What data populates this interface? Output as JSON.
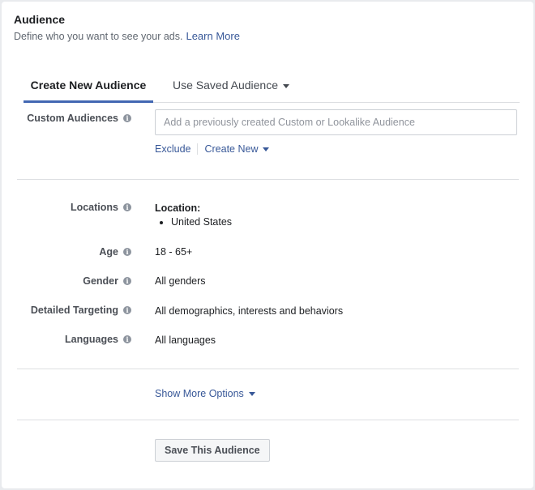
{
  "header": {
    "title": "Audience",
    "subtitle": "Define who you want to see your ads.",
    "learn_more": "Learn More"
  },
  "tabs": [
    {
      "label": "Create New Audience",
      "active": true
    },
    {
      "label": "Use Saved Audience",
      "active": false
    }
  ],
  "custom_audiences": {
    "label": "Custom Audiences",
    "placeholder": "Add a previously created Custom or Lookalike Audience",
    "value": "",
    "exclude": "Exclude",
    "create_new": "Create New"
  },
  "targeting": {
    "locations": {
      "label": "Locations",
      "heading": "Location:",
      "items": [
        "United States"
      ]
    },
    "age": {
      "label": "Age",
      "value": "18 - 65+"
    },
    "gender": {
      "label": "Gender",
      "value": "All genders"
    },
    "detailed": {
      "label": "Detailed Targeting",
      "value": "All demographics, interests and behaviors"
    },
    "languages": {
      "label": "Languages",
      "value": "All languages"
    }
  },
  "show_more": "Show More Options",
  "save_button": "Save This Audience",
  "colors": {
    "accent": "#4267b2",
    "link": "#385898"
  },
  "icons": {
    "info": "info-circle-icon",
    "caret": "caret-down-icon"
  }
}
